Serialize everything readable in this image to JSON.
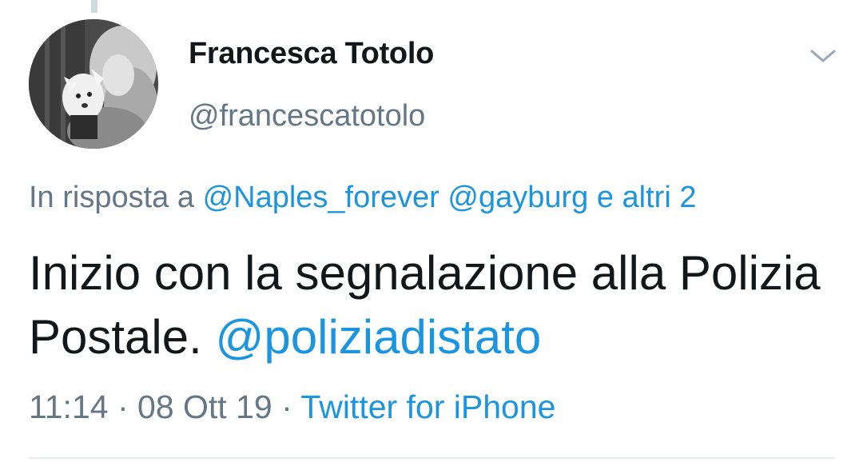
{
  "author": {
    "display_name": "Francesca Totolo",
    "handle": "@francescatotolo",
    "avatar": "profile-photo-woman-with-dog"
  },
  "reply": {
    "prefix": "In risposta a",
    "mentions": [
      "@Naples_forever",
      "@gayburg"
    ],
    "others": "e altri 2"
  },
  "tweet": {
    "text": "Inizio con la segnalazione alla Polizia Postale.",
    "mention": "@poliziadistato"
  },
  "meta": {
    "time": "11:14",
    "separator": "·",
    "date": "08 Ott 19",
    "source": "Twitter for iPhone"
  },
  "icons": {
    "menu": "chevron-down-icon"
  },
  "colors": {
    "link": "#1b95e0",
    "secondary_text": "#657786",
    "primary_text": "#14171a"
  }
}
